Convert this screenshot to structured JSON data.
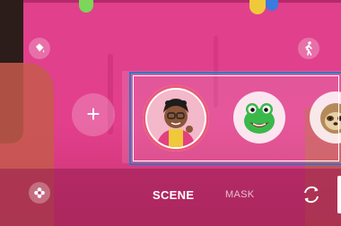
{
  "scene": {
    "overlay_color": "#e23f8c"
  },
  "toolbar": {
    "paint_icon": "paint-bucket-icon",
    "person_icon": "walking-person-icon",
    "add_label": "+"
  },
  "carousel": {
    "items": [
      {
        "name": "my-emoji",
        "selected": true
      },
      {
        "name": "frog"
      },
      {
        "name": "sloth"
      }
    ],
    "highlight_color": "#1e7fc8"
  },
  "bottom_bar": {
    "tabs": [
      {
        "label": "SCENE",
        "active": true
      },
      {
        "label": "MASK",
        "active": false
      }
    ],
    "flower_icon": "flower-icon",
    "switch_icon": "switch-camera-icon"
  }
}
